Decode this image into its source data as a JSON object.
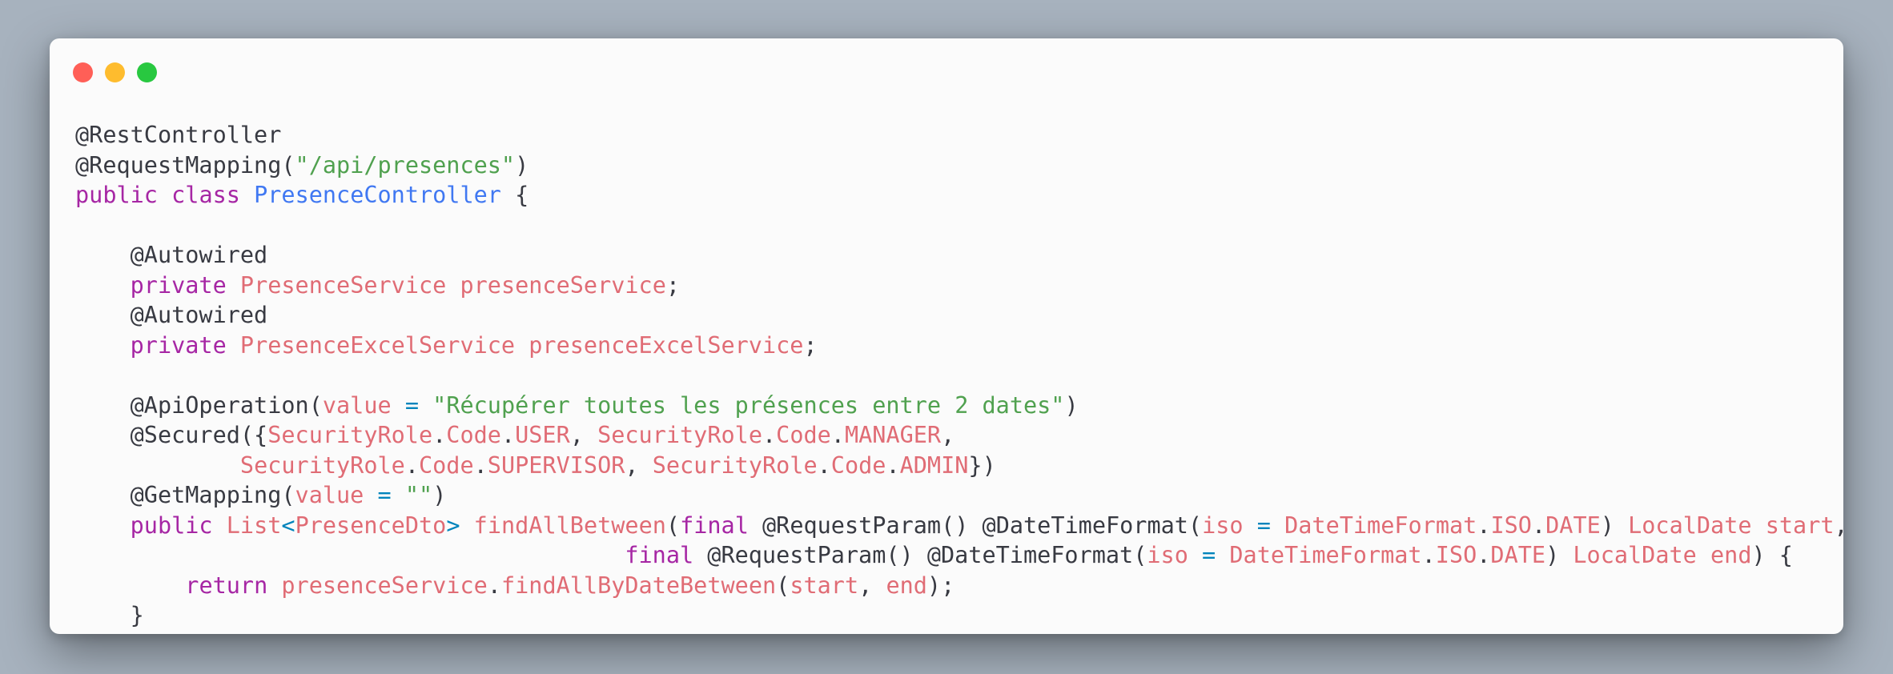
{
  "window": {
    "controls": [
      "close",
      "minimize",
      "zoom"
    ]
  },
  "code": {
    "language": "java",
    "lines": [
      [
        {
          "t": "@RestController",
          "c": "def"
        }
      ],
      [
        {
          "t": "@RequestMapping(",
          "c": "def"
        },
        {
          "t": "\"/api/presences\"",
          "c": "str"
        },
        {
          "t": ")",
          "c": "def"
        }
      ],
      [
        {
          "t": "public",
          "c": "kw"
        },
        {
          "t": " ",
          "c": "def"
        },
        {
          "t": "class",
          "c": "kw"
        },
        {
          "t": " ",
          "c": "def"
        },
        {
          "t": "PresenceController",
          "c": "cls"
        },
        {
          "t": " {",
          "c": "def"
        }
      ],
      [],
      [
        {
          "t": "    @Autowired",
          "c": "def"
        }
      ],
      [
        {
          "t": "    ",
          "c": "def"
        },
        {
          "t": "private",
          "c": "kw"
        },
        {
          "t": " ",
          "c": "def"
        },
        {
          "t": "PresenceService",
          "c": "ty"
        },
        {
          "t": " ",
          "c": "def"
        },
        {
          "t": "presenceService",
          "c": "ty"
        },
        {
          "t": ";",
          "c": "def"
        }
      ],
      [
        {
          "t": "    @Autowired",
          "c": "def"
        }
      ],
      [
        {
          "t": "    ",
          "c": "def"
        },
        {
          "t": "private",
          "c": "kw"
        },
        {
          "t": " ",
          "c": "def"
        },
        {
          "t": "PresenceExcelService",
          "c": "ty"
        },
        {
          "t": " ",
          "c": "def"
        },
        {
          "t": "presenceExcelService",
          "c": "ty"
        },
        {
          "t": ";",
          "c": "def"
        }
      ],
      [],
      [
        {
          "t": "    @ApiOperation(",
          "c": "def"
        },
        {
          "t": "value",
          "c": "ty"
        },
        {
          "t": " ",
          "c": "def"
        },
        {
          "t": "=",
          "c": "op"
        },
        {
          "t": " ",
          "c": "def"
        },
        {
          "t": "\"Récupérer toutes les présences entre 2 dates\"",
          "c": "str"
        },
        {
          "t": ")",
          "c": "def"
        }
      ],
      [
        {
          "t": "    @Secured({",
          "c": "def"
        },
        {
          "t": "SecurityRole",
          "c": "ty"
        },
        {
          "t": ".",
          "c": "def"
        },
        {
          "t": "Code",
          "c": "ty"
        },
        {
          "t": ".",
          "c": "def"
        },
        {
          "t": "USER",
          "c": "ty"
        },
        {
          "t": ", ",
          "c": "def"
        },
        {
          "t": "SecurityRole",
          "c": "ty"
        },
        {
          "t": ".",
          "c": "def"
        },
        {
          "t": "Code",
          "c": "ty"
        },
        {
          "t": ".",
          "c": "def"
        },
        {
          "t": "MANAGER",
          "c": "ty"
        },
        {
          "t": ",",
          "c": "def"
        }
      ],
      [
        {
          "t": "            ",
          "c": "def"
        },
        {
          "t": "SecurityRole",
          "c": "ty"
        },
        {
          "t": ".",
          "c": "def"
        },
        {
          "t": "Code",
          "c": "ty"
        },
        {
          "t": ".",
          "c": "def"
        },
        {
          "t": "SUPERVISOR",
          "c": "ty"
        },
        {
          "t": ", ",
          "c": "def"
        },
        {
          "t": "SecurityRole",
          "c": "ty"
        },
        {
          "t": ".",
          "c": "def"
        },
        {
          "t": "Code",
          "c": "ty"
        },
        {
          "t": ".",
          "c": "def"
        },
        {
          "t": "ADMIN",
          "c": "ty"
        },
        {
          "t": "})",
          "c": "def"
        }
      ],
      [
        {
          "t": "    @GetMapping(",
          "c": "def"
        },
        {
          "t": "value",
          "c": "ty"
        },
        {
          "t": " ",
          "c": "def"
        },
        {
          "t": "=",
          "c": "op"
        },
        {
          "t": " ",
          "c": "def"
        },
        {
          "t": "\"\"",
          "c": "str"
        },
        {
          "t": ")",
          "c": "def"
        }
      ],
      [
        {
          "t": "    ",
          "c": "def"
        },
        {
          "t": "public",
          "c": "kw"
        },
        {
          "t": " ",
          "c": "def"
        },
        {
          "t": "List",
          "c": "ty"
        },
        {
          "t": "<",
          "c": "op"
        },
        {
          "t": "PresenceDto",
          "c": "ty"
        },
        {
          "t": ">",
          "c": "op"
        },
        {
          "t": " ",
          "c": "def"
        },
        {
          "t": "findAllBetween",
          "c": "ty"
        },
        {
          "t": "(",
          "c": "def"
        },
        {
          "t": "final",
          "c": "kw"
        },
        {
          "t": " @RequestParam() @DateTimeFormat(",
          "c": "def"
        },
        {
          "t": "iso",
          "c": "ty"
        },
        {
          "t": " ",
          "c": "def"
        },
        {
          "t": "=",
          "c": "op"
        },
        {
          "t": " ",
          "c": "def"
        },
        {
          "t": "DateTimeFormat",
          "c": "ty"
        },
        {
          "t": ".",
          "c": "def"
        },
        {
          "t": "ISO",
          "c": "ty"
        },
        {
          "t": ".",
          "c": "def"
        },
        {
          "t": "DATE",
          "c": "ty"
        },
        {
          "t": ") ",
          "c": "def"
        },
        {
          "t": "LocalDate",
          "c": "ty"
        },
        {
          "t": " ",
          "c": "def"
        },
        {
          "t": "start",
          "c": "ty"
        },
        {
          "t": ",",
          "c": "def"
        }
      ],
      [
        {
          "t": "                                        ",
          "c": "def"
        },
        {
          "t": "final",
          "c": "kw"
        },
        {
          "t": " @RequestParam() @DateTimeFormat(",
          "c": "def"
        },
        {
          "t": "iso",
          "c": "ty"
        },
        {
          "t": " ",
          "c": "def"
        },
        {
          "t": "=",
          "c": "op"
        },
        {
          "t": " ",
          "c": "def"
        },
        {
          "t": "DateTimeFormat",
          "c": "ty"
        },
        {
          "t": ".",
          "c": "def"
        },
        {
          "t": "ISO",
          "c": "ty"
        },
        {
          "t": ".",
          "c": "def"
        },
        {
          "t": "DATE",
          "c": "ty"
        },
        {
          "t": ") ",
          "c": "def"
        },
        {
          "t": "LocalDate",
          "c": "ty"
        },
        {
          "t": " ",
          "c": "def"
        },
        {
          "t": "end",
          "c": "ty"
        },
        {
          "t": ") {",
          "c": "def"
        }
      ],
      [
        {
          "t": "        ",
          "c": "def"
        },
        {
          "t": "return",
          "c": "kw"
        },
        {
          "t": " ",
          "c": "def"
        },
        {
          "t": "presenceService",
          "c": "ty"
        },
        {
          "t": ".",
          "c": "def"
        },
        {
          "t": "findAllByDateBetween",
          "c": "ty"
        },
        {
          "t": "(",
          "c": "def"
        },
        {
          "t": "start",
          "c": "ty"
        },
        {
          "t": ", ",
          "c": "def"
        },
        {
          "t": "end",
          "c": "ty"
        },
        {
          "t": ");",
          "c": "def"
        }
      ],
      [
        {
          "t": "    }",
          "c": "def"
        }
      ]
    ]
  }
}
